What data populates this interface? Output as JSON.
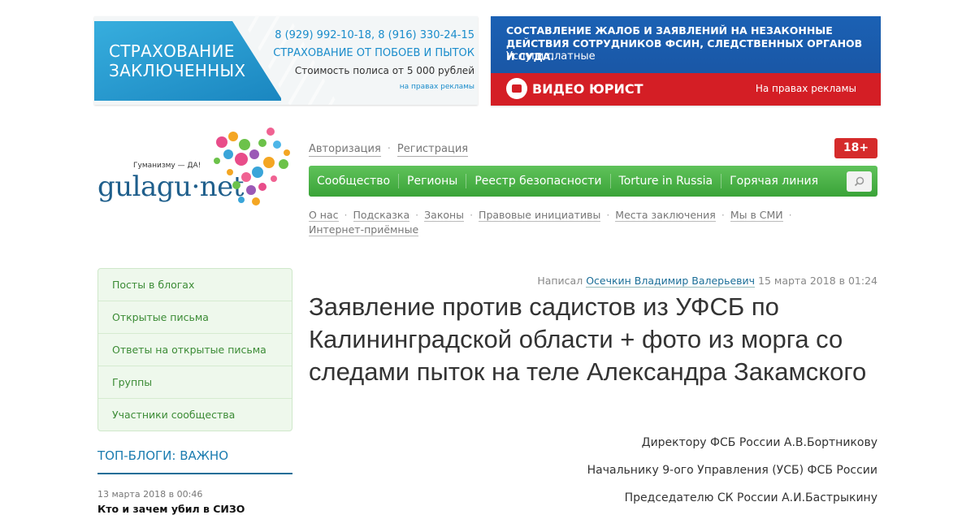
{
  "ads": {
    "left": {
      "title": "СТРАХОВАНИЕ ЗАКЛЮЧЕННЫХ",
      "phones": "8 (929) 992-10-18, 8 (916) 330-24-15",
      "tagline": "СТРАХОВАНИЕ ОТ ПОБОЕВ И ПЫТОК",
      "price": "Стоимость полиса от 5 000 рублей",
      "note": "на правах рекламы"
    },
    "right": {
      "headline": "СОСТАВЛЕНИЕ ЖАЛОБ И ЗАЯВЛЕНИЙ НА НЕЗАКОННЫЕ ДЕЙСТВИЯ СОТРУДНИКОВ ФСИН, СЛЕДСТВЕННЫХ ОРГАНОВ И СУДА.",
      "sub": "Услуги платные",
      "brand": "ВИДЕО ЮРИСТ",
      "note": "На правах рекламы"
    }
  },
  "logo": {
    "slogan": "Гуманизму — ДА!",
    "word": "gulagu·net"
  },
  "auth": {
    "login": "Авторизация",
    "register": "Регистрация",
    "sep": "·"
  },
  "age_badge": "18+",
  "mainnav": [
    "Сообщество",
    "Регионы",
    "Реестр безопасности",
    "Torture in Russia",
    "Горячая линия"
  ],
  "subnav": [
    "О нас",
    "Подсказка",
    "Законы",
    "Правовые инициативы",
    "Места заключения",
    "Мы в СМИ",
    "Интернет-приёмные"
  ],
  "sidebar": {
    "menu": [
      "Посты в блогах",
      "Открытые письма",
      "Ответы на открытые письма",
      "Группы",
      "Участники сообщества"
    ],
    "topblogs_title": "ТОП-БЛОГИ: ВАЖНО",
    "first_post": {
      "date": "13 марта 2018 в 00:46",
      "title": "Кто и зачем убил в СИЗО"
    }
  },
  "article": {
    "meta_prefix": "Написал",
    "author": "Осечкин Владимир Валерьевич",
    "date": "15 марта 2018 в 01:24",
    "title": "Заявление против садистов из УФСБ по Калининградской области + фото из морга со следами пыток на теле Александра Закамского",
    "addressees": [
      "Директору ФСБ России А.В.Бортникову",
      "Начальнику 9-ого Управления (УСБ) ФСБ России",
      "Председателю СК России А.И.Бастрыкину"
    ]
  },
  "colors": {
    "nav_green": "#45ad42",
    "link_blue": "#1b6e98",
    "sidebar_green": "#3b8b35",
    "age_red": "#d52b2b"
  }
}
